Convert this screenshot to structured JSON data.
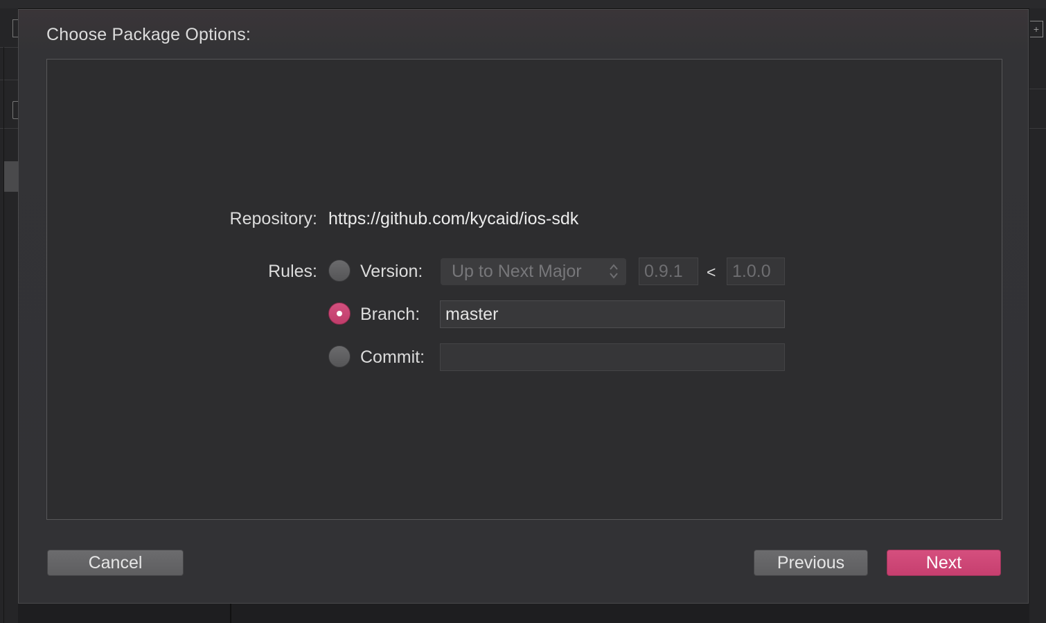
{
  "dialog": {
    "title": "Choose Package Options:"
  },
  "repository": {
    "label": "Repository:",
    "url": "https://github.com/kycaid/ios-sdk"
  },
  "rules": {
    "label": "Rules:",
    "version": {
      "label": "Version:",
      "selected": false,
      "rule_popup": "Up to Next Major",
      "lower_bound": "0.9.1",
      "operator": "<",
      "upper_bound": "1.0.0"
    },
    "branch": {
      "label": "Branch:",
      "selected": true,
      "value": "master"
    },
    "commit": {
      "label": "Commit:",
      "selected": false,
      "value": ""
    }
  },
  "buttons": {
    "cancel": "Cancel",
    "previous": "Previous",
    "next": "Next"
  },
  "colors": {
    "accent": "#C94472",
    "sheet_background": "#323235",
    "panel_background": "#2D2D2F"
  }
}
